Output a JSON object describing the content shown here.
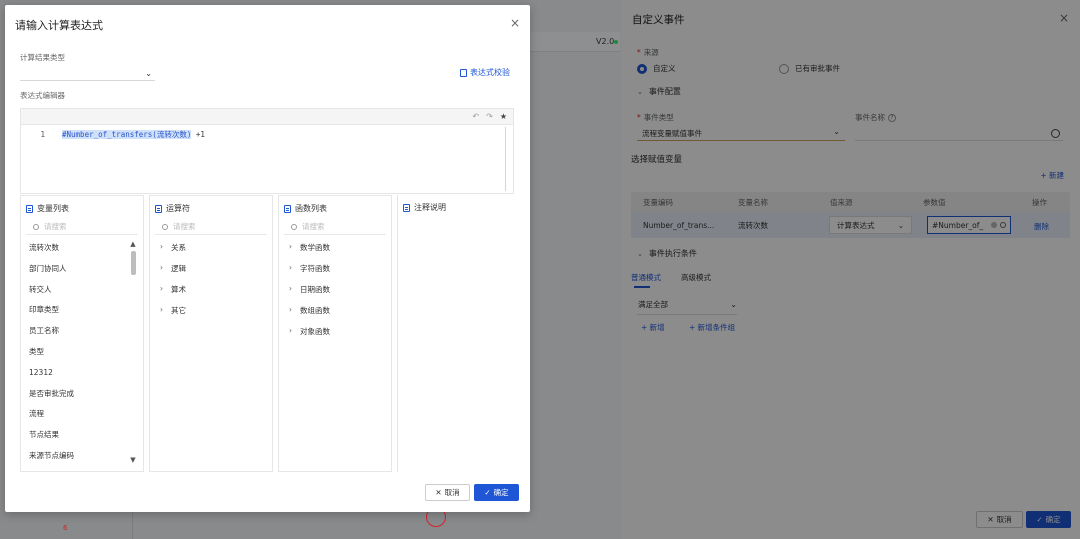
{
  "background": {
    "version": "V2.0",
    "canvas_number": "6"
  },
  "modal": {
    "title": "请输入计算表达式",
    "close_icon": "×",
    "result_type_label": "计算结果类型",
    "result_type_value": "",
    "validate_label": "表达式校验",
    "editor_label": "表达式编辑器",
    "editor_toolbar": {
      "undo": "↶",
      "redo": "↷",
      "star": "★"
    },
    "code_line_number": "1",
    "code_highlight": "#Number_of_transfers(流转次数)",
    "code_rest": " +1",
    "panels": {
      "variables": {
        "title": "变量列表",
        "search_placeholder": "请搜索",
        "items": [
          "流转次数",
          "部门协同人",
          "转交人",
          "印章类型",
          "员工名称",
          "类型",
          "12312",
          "是否审批完成",
          "流程",
          "节点结果",
          "来源节点编码"
        ]
      },
      "operators": {
        "title": "运算符",
        "search_placeholder": "请搜索",
        "items": [
          "关系",
          "逻辑",
          "算术",
          "其它"
        ]
      },
      "functions": {
        "title": "函数列表",
        "search_placeholder": "请搜索",
        "items": [
          "数学函数",
          "字符函数",
          "日期函数",
          "数组函数",
          "对象函数"
        ]
      },
      "notes": {
        "title": "注释说明"
      }
    },
    "cancel_label": "取消",
    "confirm_label": "确定"
  },
  "drawer": {
    "title": "自定义事件",
    "source_label": "来源",
    "source_options": [
      "自定义",
      "已有审批事件"
    ],
    "event_config_label": "事件配置",
    "event_type_label": "事件类型",
    "event_type_value": "流程变量赋值事件",
    "event_name_label": "事件名称",
    "help_icon": "?",
    "select_var_label": "选择赋值变量",
    "new_label": "+ 新建",
    "table": {
      "headers": [
        "变量编码",
        "变量名称",
        "值来源",
        "参数值",
        "操作"
      ],
      "row": {
        "code": "Number_of_trans...",
        "name": "流转次数",
        "value_source": "计算表达式",
        "param_value": "#Number_of_",
        "action": "删除"
      }
    },
    "condition_label": "事件执行条件",
    "tabs": [
      "普通模式",
      "高级模式"
    ],
    "match_value": "满足全部",
    "add_label": "+ 新增",
    "add_group_label": "+ 新增条件组",
    "cancel_label": "取消",
    "confirm_label": "确定"
  },
  "colors": {
    "primary": "#1e56d6",
    "required": "#e02020",
    "highlight": "#cfe0fb"
  }
}
